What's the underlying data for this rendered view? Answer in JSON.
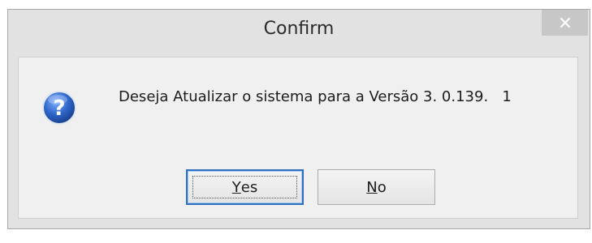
{
  "dialog": {
    "title": "Confirm",
    "message": "Deseja Atualizar o sistema para a Versão 3. 0.139.   1",
    "icon": "question-icon",
    "close_icon": "close-icon"
  },
  "buttons": {
    "yes": {
      "mnemonic": "Y",
      "rest": "es"
    },
    "no": {
      "mnemonic": "N",
      "rest": "o"
    }
  },
  "colors": {
    "frame": "#e2e2e2",
    "client": "#f0f0f0",
    "close_bg": "#c7c7c7",
    "default_button_border": "#2f6fbf",
    "icon_blue": "#1f4fa0"
  }
}
